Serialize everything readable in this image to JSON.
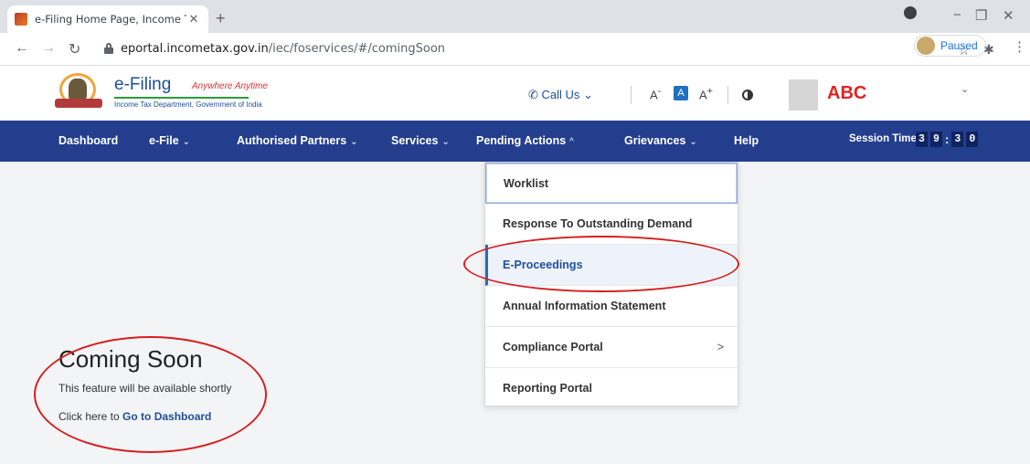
{
  "browser": {
    "tab_title": "e-Filing Home Page, Income Tax |",
    "tab_close": "✕",
    "new_tab": "+",
    "url_host": "eportal.incometax.gov.in",
    "url_path": "/iec/foservices/#/comingSoon",
    "profile_status": "Paused",
    "icons": [
      "back-arrow",
      "forward-arrow",
      "reload",
      "lock",
      "star",
      "puzzle",
      "kebab"
    ]
  },
  "site": {
    "logo_title": "e-Filing",
    "logo_tagline": "Anywhere Anytime",
    "logo_subtitle": "Income Tax Department, Government of India",
    "call_us": "Call Us",
    "font_decrease": "A",
    "font_normal": "A",
    "font_increase": "A",
    "user_name": "ABC"
  },
  "nav": {
    "items": [
      {
        "label": "Dashboard",
        "chevron": ""
      },
      {
        "label": "e-File",
        "chevron": "⌄"
      },
      {
        "label": "Authorised Partners",
        "chevron": "⌄"
      },
      {
        "label": "Services",
        "chevron": "⌄"
      },
      {
        "label": "Pending Actions",
        "chevron": "^"
      },
      {
        "label": "Grievances",
        "chevron": "⌄"
      },
      {
        "label": "Help",
        "chevron": ""
      }
    ],
    "session_label": "Session Time",
    "session_digits": [
      "3",
      "9",
      "3",
      "0"
    ]
  },
  "dropdown": {
    "items": [
      {
        "label": "Worklist"
      },
      {
        "label": "Response To Outstanding Demand"
      },
      {
        "label": "E-Proceedings"
      },
      {
        "label": "Annual Information Statement"
      },
      {
        "label": "Compliance Portal",
        "arrow": ">"
      },
      {
        "label": "Reporting Portal"
      }
    ]
  },
  "main": {
    "title": "Coming Soon",
    "subtitle": "This feature will be available shortly",
    "link_prefix": "Click here to",
    "link_text": "Go to Dashboard"
  },
  "colors": {
    "nav_bg": "#243e8e",
    "highlight": "#d42020",
    "brand_blue": "#1f4e9a",
    "user_red": "#e02424"
  }
}
